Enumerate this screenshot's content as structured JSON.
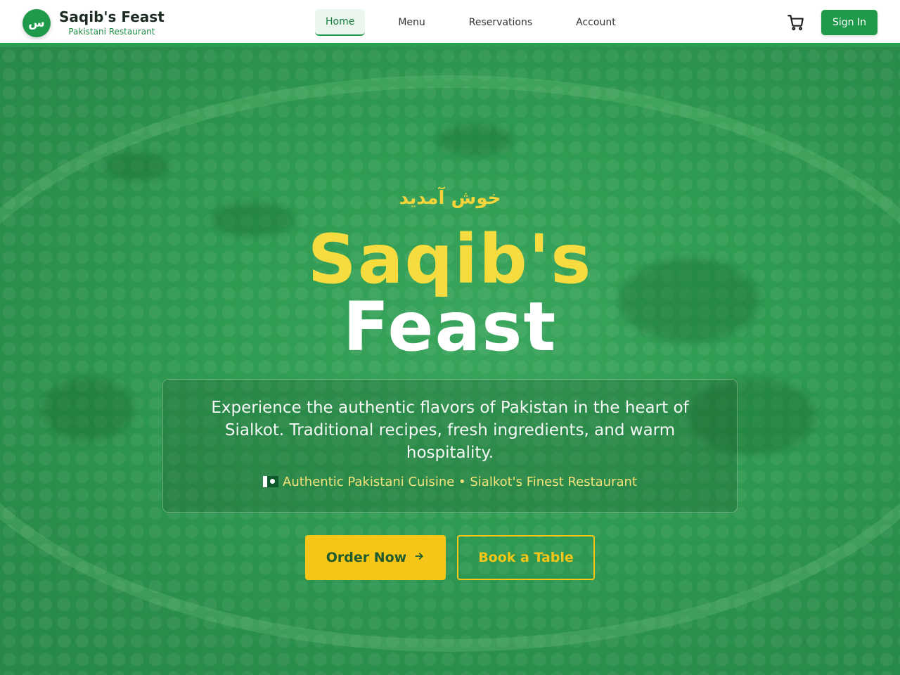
{
  "brand": {
    "logo_letter": "س",
    "name": "Saqib's Feast",
    "subtitle": "Pakistani Restaurant"
  },
  "nav": {
    "items": [
      {
        "label": "Home",
        "active": true
      },
      {
        "label": "Menu",
        "active": false
      },
      {
        "label": "Reservations",
        "active": false
      },
      {
        "label": "Account",
        "active": false
      }
    ]
  },
  "header": {
    "cart_icon": "cart-icon",
    "signin_label": "Sign In"
  },
  "hero": {
    "greeting": "خوش آمدید",
    "title_line1": "Saqib's",
    "title_line2": "Feast",
    "description": "Experience the authentic flavors of Pakistan in the heart of Sialkot. Traditional recipes, fresh ingredients, and warm hospitality.",
    "tagline": "Authentic Pakistani Cuisine • Sialkot's Finest Restaurant",
    "order_label": "Order Now",
    "book_label": "Book a Table"
  },
  "colors": {
    "primary": "#1f9a4a",
    "accent": "#f5c518",
    "hero_bg": "#2f9b52"
  }
}
